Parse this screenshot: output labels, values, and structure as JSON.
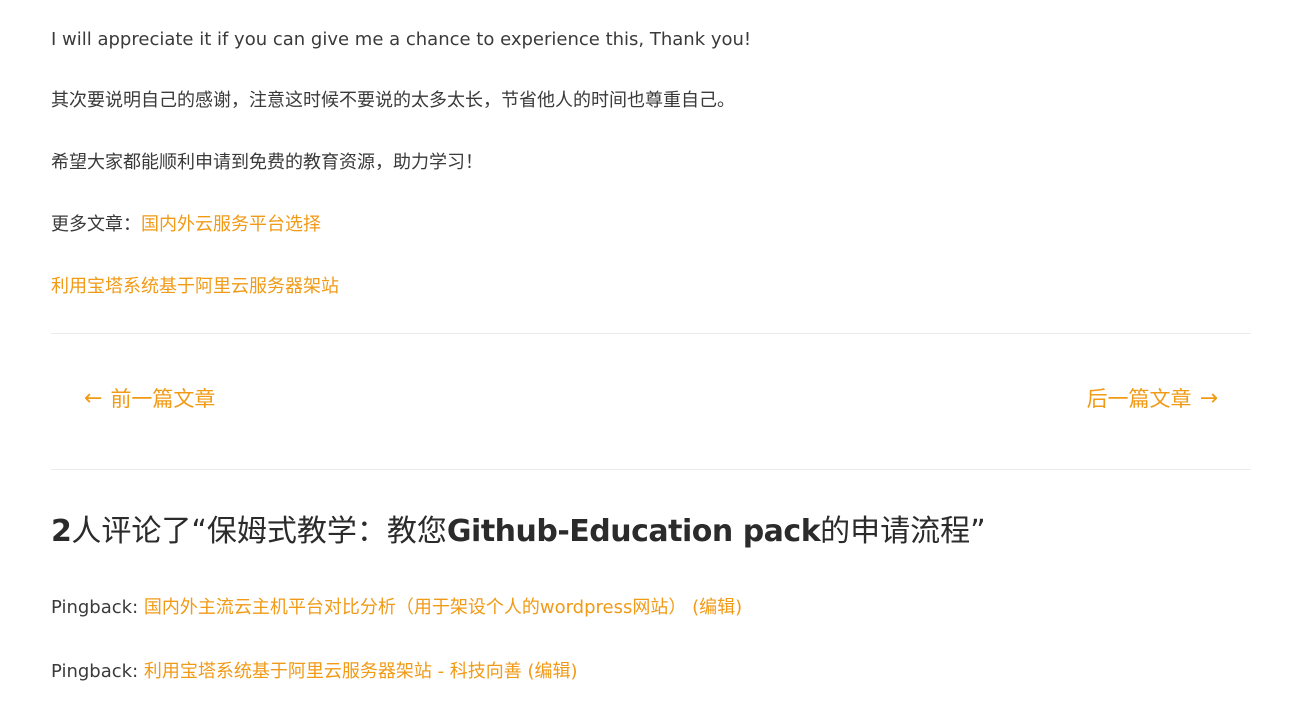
{
  "article": {
    "thanks_sentence": "I will appreciate it if you can give me a chance to experience this, Thank you!",
    "advice_sentence": "其次要说明自己的感谢，注意这时候不要说的太多太长，节省他人的时间也尊重自己。",
    "wish_sentence": "希望大家都能顺利申请到免费的教育资源，助力学习！",
    "more_label": "更多文章：",
    "more_link_1": "国内外云服务平台选择",
    "more_link_2": "利用宝塔系统基于阿里云服务器架站"
  },
  "post_nav": {
    "prev_arrow": "←",
    "prev_label": "前一篇文章",
    "next_label": "后一篇文章",
    "next_arrow": "→"
  },
  "comments": {
    "count": "2",
    "title_prefix": "人评论了“保姆式教学：教您",
    "title_bold": "Github-Education pack",
    "title_suffix": "的申请流程”",
    "pingbacks": [
      {
        "label": "Pingback: ",
        "link": "国内外主流云主机平台对比分析（用于架设个人的wordpress网站）",
        "edit": "(编辑)"
      },
      {
        "label": "Pingback: ",
        "link": "利用宝塔系统基于阿里云服务器架站 - 科技向善",
        "edit": "(编辑)"
      }
    ]
  },
  "colors": {
    "text": "#3a3a3a",
    "link": "#f09a16",
    "divider": "#ebebeb"
  }
}
